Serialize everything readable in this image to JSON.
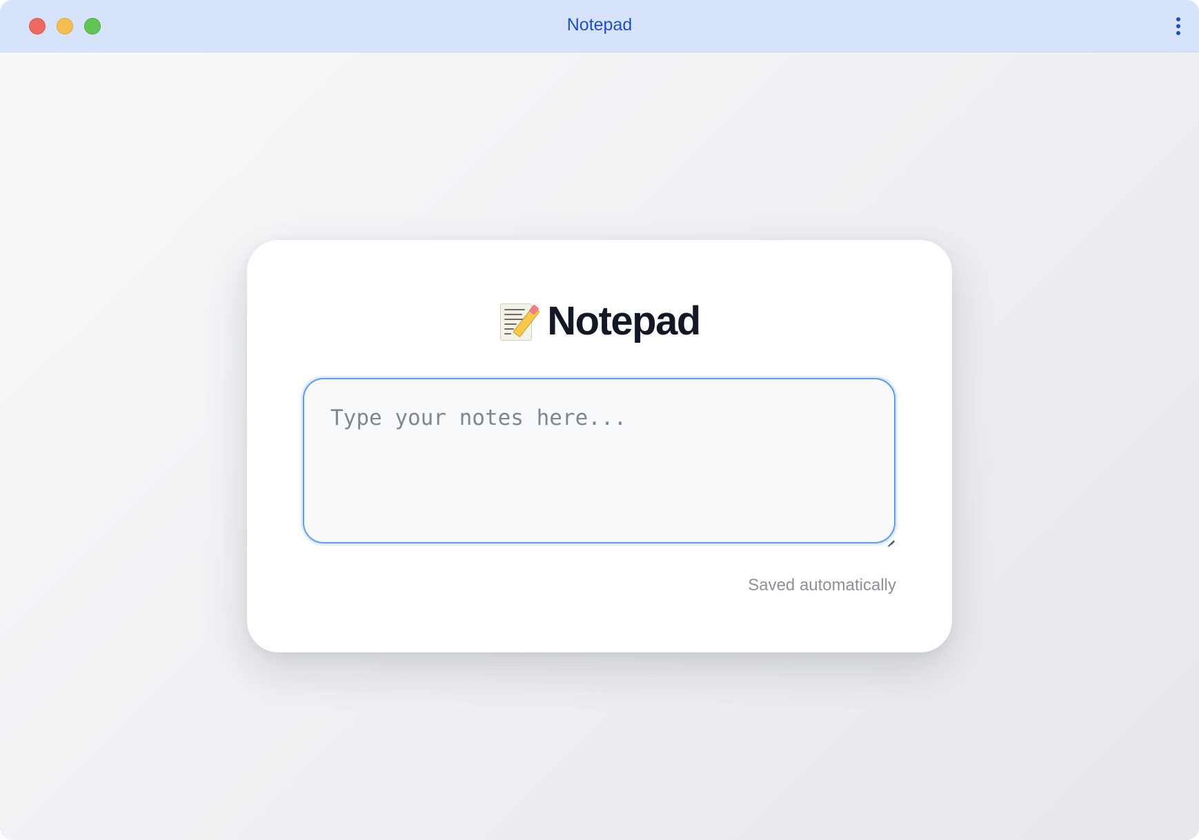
{
  "window": {
    "title": "Notepad",
    "controls": [
      "close",
      "minimize",
      "maximize"
    ],
    "menu_icon": "more-vertical-icon"
  },
  "app": {
    "icon": "memo-icon",
    "heading": "Notepad",
    "notes": {
      "value": "",
      "placeholder": "Type your notes here..."
    },
    "status": "Saved automatically"
  },
  "colors": {
    "titlebar": "#d7e2fb",
    "title_text": "#1f4fc4",
    "focus_border": "#5b9cf0",
    "heading_text": "#141826",
    "status_text": "#8b909a"
  }
}
